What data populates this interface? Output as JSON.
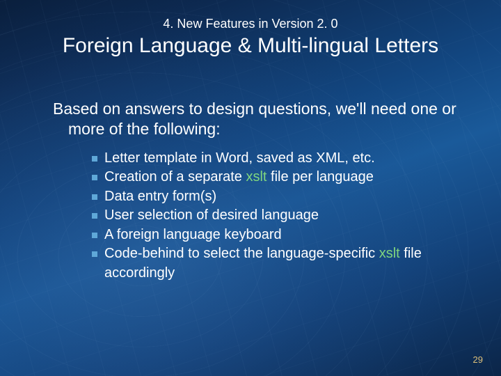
{
  "heading": {
    "overline": "4. New Features in Version 2. 0",
    "title": "Foreign Language & Multi-lingual Letters"
  },
  "intro": "Based on answers to design questions, we'll need one or more of the following:",
  "bullets": [
    {
      "pre": "Letter template in Word, saved as XML, etc.",
      "kw": "",
      "post": ""
    },
    {
      "pre": "Creation of a separate ",
      "kw": "xslt",
      "post": " file per language"
    },
    {
      "pre": "Data entry form(s)",
      "kw": "",
      "post": ""
    },
    {
      "pre": "User selection of desired language",
      "kw": "",
      "post": ""
    },
    {
      "pre": "A foreign language keyboard",
      "kw": "",
      "post": ""
    },
    {
      "pre": "Code-behind to select the language-specific ",
      "kw": "xslt",
      "post": " file accordingly"
    }
  ],
  "page_number": "29"
}
